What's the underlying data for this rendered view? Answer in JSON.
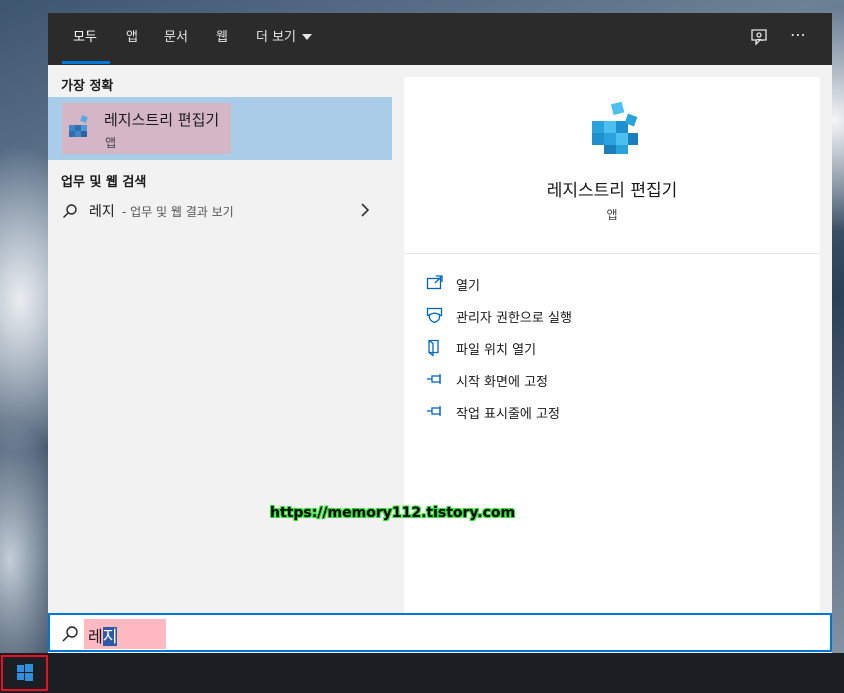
{
  "colors": {
    "accent": "#0078d7",
    "nav_bg": "#2b2b2b",
    "selection_bg": "#a9cde9",
    "highlight_pink": "#ffb9c0",
    "start_outline": "#e81123"
  },
  "nav": {
    "tabs": [
      {
        "label": "모두",
        "active": true
      },
      {
        "label": "앱"
      },
      {
        "label": "문서"
      },
      {
        "label": "웹"
      },
      {
        "label": "더 보기"
      }
    ],
    "icons": [
      "feedback-icon",
      "more-options-icon"
    ],
    "more_label": "⋯"
  },
  "left": {
    "best_match_title": "가장 정확",
    "best_match": {
      "name": "레지스트리 편집기",
      "type": "앱",
      "icon": "registry-editor-icon"
    },
    "web_section_title": "업무 및 웹 검색",
    "web_result": {
      "query": "레지",
      "suffix": "- 업무 및 웹 결과 보기"
    }
  },
  "right": {
    "app_name": "레지스트리 편집기",
    "app_type": "앱",
    "actions": [
      {
        "label": "열기",
        "icon": "open-icon"
      },
      {
        "label": "관리자 권한으로 실행",
        "icon": "shield-icon"
      },
      {
        "label": "파일 위치 열기",
        "icon": "file-location-icon"
      },
      {
        "label": "시작 화면에 고정",
        "icon": "pin-icon"
      },
      {
        "label": "작업 표시줄에 고정",
        "icon": "pin-icon"
      }
    ]
  },
  "search": {
    "value_prefix": "레",
    "value_selected": "지"
  },
  "watermark": "https://memory112.tistory.com"
}
